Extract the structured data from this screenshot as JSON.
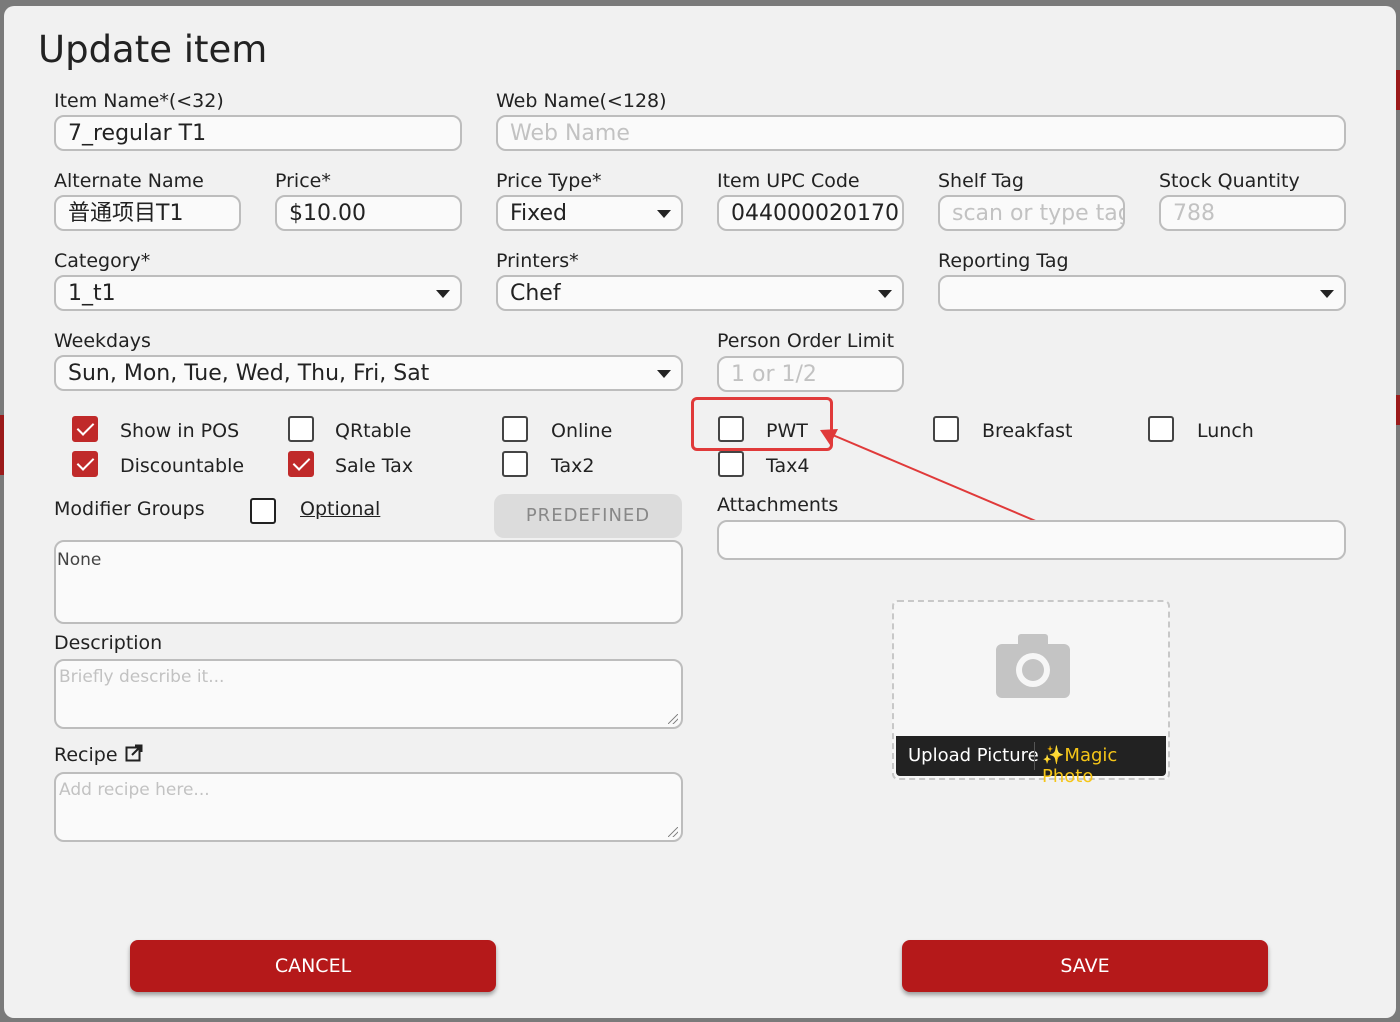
{
  "dialog": {
    "title": "Update item"
  },
  "fields": {
    "item_name": {
      "label": "Item Name*(<32)",
      "value": "7_regular T1"
    },
    "web_name": {
      "label": "Web Name(<128)",
      "placeholder": "Web Name"
    },
    "alternate_name": {
      "label": "Alternate Name",
      "value": "普通项目T1"
    },
    "price": {
      "label": "Price*",
      "value": "$10.00"
    },
    "price_type": {
      "label": "Price Type*",
      "value": "Fixed"
    },
    "upc": {
      "label": "Item UPC Code",
      "value": "044000020170"
    },
    "shelf_tag": {
      "label": "Shelf Tag",
      "placeholder": "scan or type tag"
    },
    "stock_quantity": {
      "label": "Stock Quantity",
      "placeholder": "788"
    },
    "category": {
      "label": "Category*",
      "value": "1_t1"
    },
    "printers": {
      "label": "Printers*",
      "value": "Chef"
    },
    "reporting_tag": {
      "label": "Reporting Tag",
      "value": ""
    },
    "weekdays": {
      "label": "Weekdays",
      "value": "Sun, Mon, Tue, Wed, Thu, Fri, Sat"
    },
    "person_order_limit": {
      "label": "Person Order Limit",
      "placeholder": "1 or 1/2"
    }
  },
  "checkboxes": [
    {
      "label": "Show in POS",
      "checked": true
    },
    {
      "label": "QRtable",
      "checked": false
    },
    {
      "label": "Online",
      "checked": false
    },
    {
      "label": "PWT",
      "checked": false
    },
    {
      "label": "Breakfast",
      "checked": false
    },
    {
      "label": "Lunch",
      "checked": false
    },
    {
      "label": "Discountable",
      "checked": true
    },
    {
      "label": "Sale Tax",
      "checked": true
    },
    {
      "label": "Tax2",
      "checked": false
    },
    {
      "label": "Tax4",
      "checked": false
    }
  ],
  "modifier_groups": {
    "label": "Modifier Groups",
    "optional_label": "Optional",
    "predefined_label": "PREDEFINED",
    "value": "None"
  },
  "attachments": {
    "label": "Attachments"
  },
  "description": {
    "label": "Description",
    "placeholder": "Briefly describe it..."
  },
  "recipe": {
    "label": "Recipe",
    "placeholder": "Add recipe here...",
    "icon": "external-link-icon"
  },
  "upload": {
    "upload_label": "Upload Picture",
    "magic_label": "Magic Photo",
    "icon": "camera-icon",
    "magic_icon": "sparkle-icon"
  },
  "buttons": {
    "cancel": "CANCEL",
    "save": "SAVE"
  },
  "colors": {
    "accent": "#b5191a",
    "checkbox_checked": "#c02a2a",
    "highlight": "#e03a3a"
  }
}
